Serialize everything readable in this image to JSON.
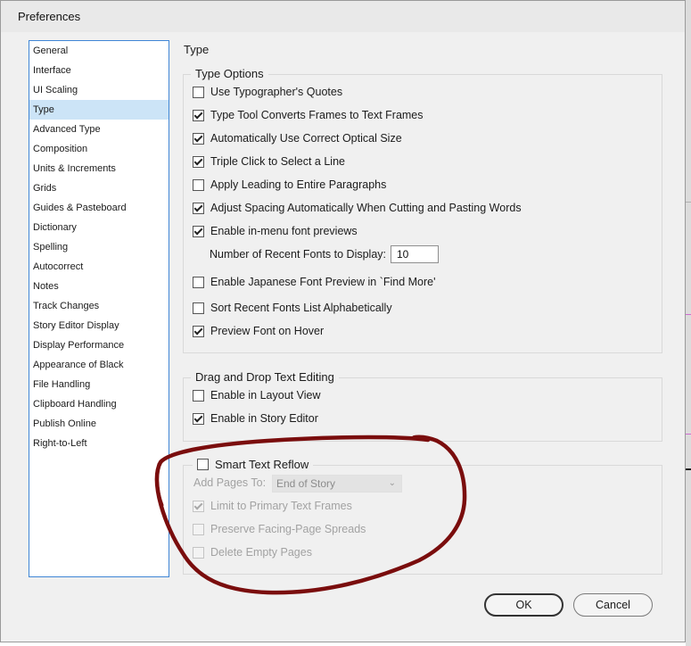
{
  "window": {
    "title": "Preferences"
  },
  "sidebar": {
    "items": [
      {
        "label": "General"
      },
      {
        "label": "Interface"
      },
      {
        "label": "UI Scaling"
      },
      {
        "label": "Type",
        "selected": true
      },
      {
        "label": "Advanced Type"
      },
      {
        "label": "Composition"
      },
      {
        "label": "Units & Increments"
      },
      {
        "label": "Grids"
      },
      {
        "label": "Guides & Pasteboard"
      },
      {
        "label": "Dictionary"
      },
      {
        "label": "Spelling"
      },
      {
        "label": "Autocorrect"
      },
      {
        "label": "Notes"
      },
      {
        "label": "Track Changes"
      },
      {
        "label": "Story Editor Display"
      },
      {
        "label": "Display Performance"
      },
      {
        "label": "Appearance of Black"
      },
      {
        "label": "File Handling"
      },
      {
        "label": "Clipboard Handling"
      },
      {
        "label": "Publish Online"
      },
      {
        "label": "Right-to-Left"
      }
    ]
  },
  "main": {
    "section_title": "Type",
    "type_options": {
      "legend": "Type Options",
      "use_typographers_quotes": {
        "label": "Use Typographer's Quotes",
        "checked": false
      },
      "type_tool_converts": {
        "label": "Type Tool Converts Frames to Text Frames",
        "checked": true
      },
      "optical_size": {
        "label": "Automatically Use Correct Optical Size",
        "checked": true
      },
      "triple_click": {
        "label": "Triple Click to Select a Line",
        "checked": true
      },
      "apply_leading": {
        "label": "Apply Leading to Entire Paragraphs",
        "checked": false
      },
      "adjust_spacing": {
        "label": "Adjust Spacing Automatically When Cutting and Pasting Words",
        "checked": true
      },
      "in_menu_previews": {
        "label": "Enable in-menu font previews",
        "checked": true
      },
      "recent_fonts_label": "Number of Recent Fonts to Display:",
      "recent_fonts_value": "10",
      "japanese_preview": {
        "label": "Enable Japanese Font Preview in `Find More'",
        "checked": false
      },
      "sort_recent": {
        "label": "Sort Recent Fonts List Alphabetically",
        "checked": false
      },
      "preview_hover": {
        "label": "Preview Font on Hover",
        "checked": true
      }
    },
    "drag_drop": {
      "legend": "Drag and Drop Text Editing",
      "layout_view": {
        "label": "Enable in Layout View",
        "checked": false
      },
      "story_editor": {
        "label": "Enable in Story Editor",
        "checked": true
      }
    },
    "smart_reflow": {
      "label": "Smart Text Reflow",
      "checked": false,
      "add_pages_label": "Add Pages To:",
      "add_pages_value": "End of Story",
      "limit_primary": {
        "label": "Limit to Primary Text Frames",
        "checked": true
      },
      "preserve_spreads": {
        "label": "Preserve Facing-Page Spreads",
        "checked": false
      },
      "delete_empty": {
        "label": "Delete Empty Pages",
        "checked": false
      }
    }
  },
  "buttons": {
    "ok": "OK",
    "cancel": "Cancel"
  },
  "icons": {
    "dropdown": "chevron-down-icon",
    "checkbox_check": "checkmark-icon"
  },
  "colors": {
    "selection": "#cce4f7",
    "list_border": "#3f86d6",
    "annotation": "#7a0d0d"
  }
}
